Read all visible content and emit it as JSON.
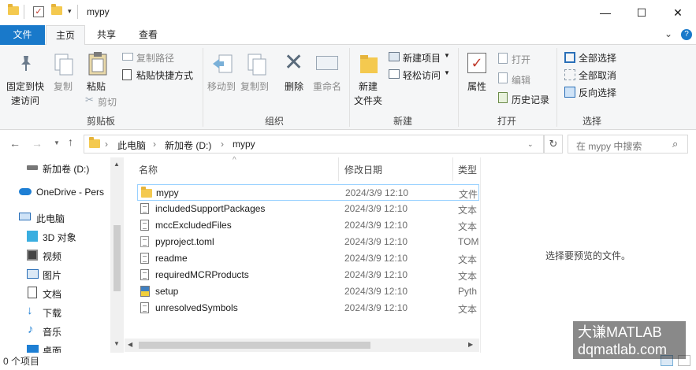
{
  "window": {
    "title": "mypy",
    "minimize_glyph": "—",
    "maximize_glyph": "☐",
    "close_glyph": "✕",
    "collapse_glyph": "⌄",
    "help_glyph": "?"
  },
  "tabs": [
    {
      "label": "文件"
    },
    {
      "label": "主页"
    },
    {
      "label": "共享"
    },
    {
      "label": "查看"
    }
  ],
  "ribbon": {
    "clipboard": {
      "group": "剪贴板",
      "pin_quick_access": "固定到快",
      "pin_quick_access_2": "速访问",
      "copy": "复制",
      "paste": "粘贴",
      "copy_path": "复制路径",
      "paste_shortcut": "粘贴快捷方式",
      "cut": "剪切"
    },
    "organize": {
      "group": "组织",
      "move_to": "移动到",
      "copy_to": "复制到",
      "delete": "删除",
      "rename": "重命名"
    },
    "new": {
      "group": "新建",
      "new_folder": "新建",
      "new_folder_2": "文件夹",
      "new_item": "新建项目",
      "easy_access": "轻松访问"
    },
    "open": {
      "group": "打开",
      "properties": "属性",
      "open": "打开",
      "edit": "编辑",
      "history": "历史记录"
    },
    "select": {
      "group": "选择",
      "select_all": "全部选择",
      "select_none": "全部取消",
      "invert": "反向选择"
    }
  },
  "address": {
    "crumbs": [
      "此电脑",
      "新加卷 (D:)",
      "mypy"
    ],
    "search_placeholder": "在 mypy 中搜索"
  },
  "nav": {
    "items": [
      {
        "label": "新加卷 (D:)"
      },
      {
        "label": "OneDrive - Pers"
      },
      {
        "label": "此电脑"
      },
      {
        "label": "3D 对象"
      },
      {
        "label": "视频"
      },
      {
        "label": "图片"
      },
      {
        "label": "文档"
      },
      {
        "label": "下载"
      },
      {
        "label": "音乐"
      },
      {
        "label": "桌面"
      }
    ]
  },
  "list": {
    "columns": {
      "name": "名称",
      "date": "修改日期",
      "type": "类型"
    },
    "rows": [
      {
        "name": "mypy",
        "date": "2024/3/9 12:10",
        "type": "文件"
      },
      {
        "name": "includedSupportPackages",
        "date": "2024/3/9 12:10",
        "type": "文本"
      },
      {
        "name": "mccExcludedFiles",
        "date": "2024/3/9 12:10",
        "type": "文本"
      },
      {
        "name": "pyproject.toml",
        "date": "2024/3/9 12:10",
        "type": "TOM"
      },
      {
        "name": "readme",
        "date": "2024/3/9 12:10",
        "type": "文本"
      },
      {
        "name": "requiredMCRProducts",
        "date": "2024/3/9 12:10",
        "type": "文本"
      },
      {
        "name": "setup",
        "date": "2024/3/9 12:10",
        "type": "Pyth"
      },
      {
        "name": "unresolvedSymbols",
        "date": "2024/3/9 12:10",
        "type": "文本"
      }
    ]
  },
  "preview": {
    "message": "选择要预览的文件。"
  },
  "status": {
    "count": "0 个项目"
  },
  "watermark": {
    "line1": "大谦MATLAB",
    "line2": "dqmatlab.com"
  },
  "colors": {
    "accent": "#1979ca",
    "folder": "#f4c94f",
    "selection_border": "#99d1ff"
  }
}
